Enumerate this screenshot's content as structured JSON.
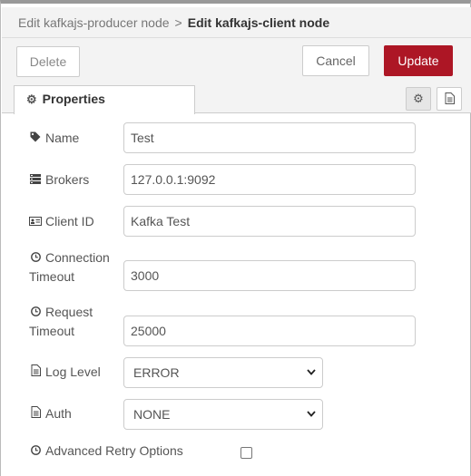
{
  "breadcrumb": {
    "parent": "Edit kafkajs-producer node",
    "separator": ">",
    "current": "Edit kafkajs-client node"
  },
  "toolbar": {
    "delete_label": "Delete",
    "cancel_label": "Cancel",
    "update_label": "Update"
  },
  "tabs": {
    "properties_label": "Properties"
  },
  "form": {
    "name_label": "Name",
    "name_value": "Test",
    "brokers_label": "Brokers",
    "brokers_value": "127.0.0.1:9092",
    "clientid_label": "Client ID",
    "clientid_value": "Kafka Test",
    "conntimeout_label_1": "Connection",
    "conntimeout_label_2": "Timeout",
    "conntimeout_value": "3000",
    "reqtimeout_label_1": "Request",
    "reqtimeout_label_2": "Timeout",
    "reqtimeout_value": "25000",
    "loglevel_label": "Log Level",
    "loglevel_value": "ERROR",
    "auth_label": "Auth",
    "auth_value": "NONE",
    "retry_label": "Advanced Retry Options",
    "retry_checked": false
  },
  "colors": {
    "update_button": "#ad1625",
    "tray_background": "#ffffff",
    "header_background": "#f3f3f3"
  },
  "icons": {
    "settings": "gear-icon",
    "description": "file-text-icon",
    "name": "tag-icon",
    "brokers": "server-icon",
    "clientid": "id-card-icon",
    "timeout": "clock-icon",
    "loglevel": "file-icon",
    "auth": "file-icon"
  }
}
